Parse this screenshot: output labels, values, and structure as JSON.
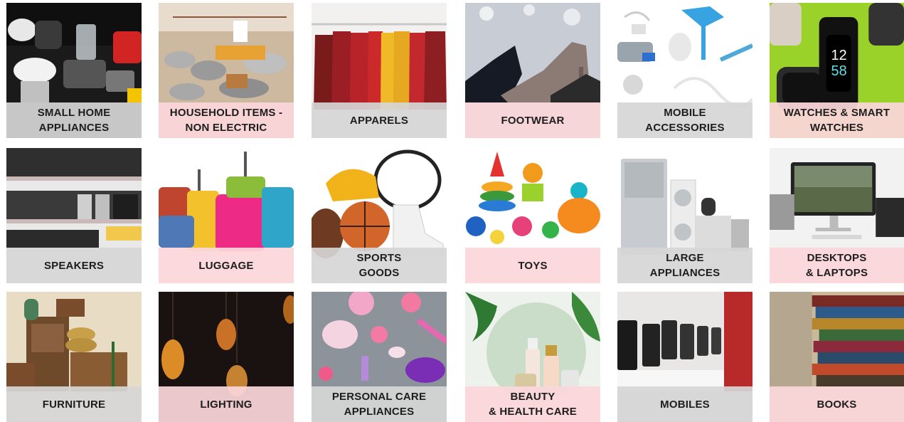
{
  "categories": [
    {
      "label": "SMALL HOME\nAPPLIANCES",
      "label_bg": "grey"
    },
    {
      "label": "HOUSEHOLD ITEMS -\nNON ELECTRIC",
      "label_bg": "pink"
    },
    {
      "label": "APPARELS",
      "label_bg": "grey"
    },
    {
      "label": "FOOTWEAR",
      "label_bg": "pink"
    },
    {
      "label": "MOBILE\nACCESSORIES",
      "label_bg": "grey"
    },
    {
      "label": "WATCHES & SMART\nWATCHES",
      "label_bg": "pink"
    },
    {
      "label": "SPEAKERS",
      "label_bg": "grey"
    },
    {
      "label": "LUGGAGE",
      "label_bg": "pink"
    },
    {
      "label": "SPORTS\nGOODS",
      "label_bg": "grey"
    },
    {
      "label": "TOYS",
      "label_bg": "pink"
    },
    {
      "label": "LARGE\nAPPLIANCES",
      "label_bg": "grey"
    },
    {
      "label": "DESKTOPS\n& LAPTOPS",
      "label_bg": "pink"
    },
    {
      "label": "FURNITURE",
      "label_bg": "grey"
    },
    {
      "label": "LIGHTING",
      "label_bg": "pink"
    },
    {
      "label": "PERSONAL CARE\nAPPLIANCES",
      "label_bg": "grey"
    },
    {
      "label": "BEAUTY\n& HEALTH CARE",
      "label_bg": "pink"
    },
    {
      "label": "MOBILES",
      "label_bg": "grey"
    },
    {
      "label": "BOOKS",
      "label_bg": "pink"
    }
  ],
  "colors": {
    "label_grey": "#d6d6d6",
    "label_pink": "#fbd6da",
    "label_text": "#1d1d1d"
  }
}
